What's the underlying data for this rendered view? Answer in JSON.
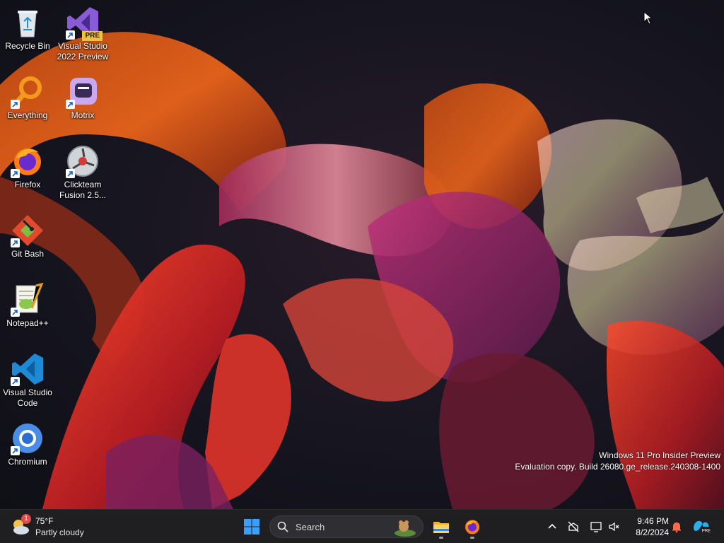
{
  "desktop": {
    "icons": [
      {
        "label": "Recycle Bin",
        "icon": "recycle-bin-icon"
      },
      {
        "label": "Visual Studio 2022 Preview",
        "icon": "visual-studio-preview-icon",
        "badge": "PRE"
      },
      {
        "label": "Everything",
        "icon": "everything-search-icon"
      },
      {
        "label": "Motrix",
        "icon": "motrix-icon"
      },
      {
        "label": "Firefox",
        "icon": "firefox-icon"
      },
      {
        "label": "Clickteam Fusion 2.5...",
        "icon": "clickteam-fusion-icon"
      },
      {
        "label": "Git Bash",
        "icon": "git-bash-icon"
      },
      {
        "label": "Notepad++",
        "icon": "notepad-plus-plus-icon"
      },
      {
        "label": "Visual Studio Code",
        "icon": "vscode-icon"
      },
      {
        "label": "Chromium",
        "icon": "chromium-icon"
      }
    ],
    "watermark": {
      "line1": "Windows 11 Pro Insider Preview",
      "line2": "Evaluation copy. Build 26080.ge_release.240308-1400"
    }
  },
  "taskbar": {
    "weather": {
      "temp": "75°F",
      "condition": "Partly cloudy",
      "badge": "1"
    },
    "search": {
      "label": "Search"
    },
    "apps": [
      "file-explorer-icon",
      "firefox-icon"
    ],
    "clock": {
      "time": "9:46 PM",
      "date": "8/2/2024"
    },
    "tray": [
      "chevron-up-icon",
      "network-off-icon",
      "display-icon",
      "volume-muted-icon",
      "notification-bell-icon",
      "copilot-icon"
    ]
  },
  "colors": {
    "taskbar": "#1f1f22",
    "windows_blue": "#3aa0ff",
    "badge_red": "#e04b4b"
  }
}
